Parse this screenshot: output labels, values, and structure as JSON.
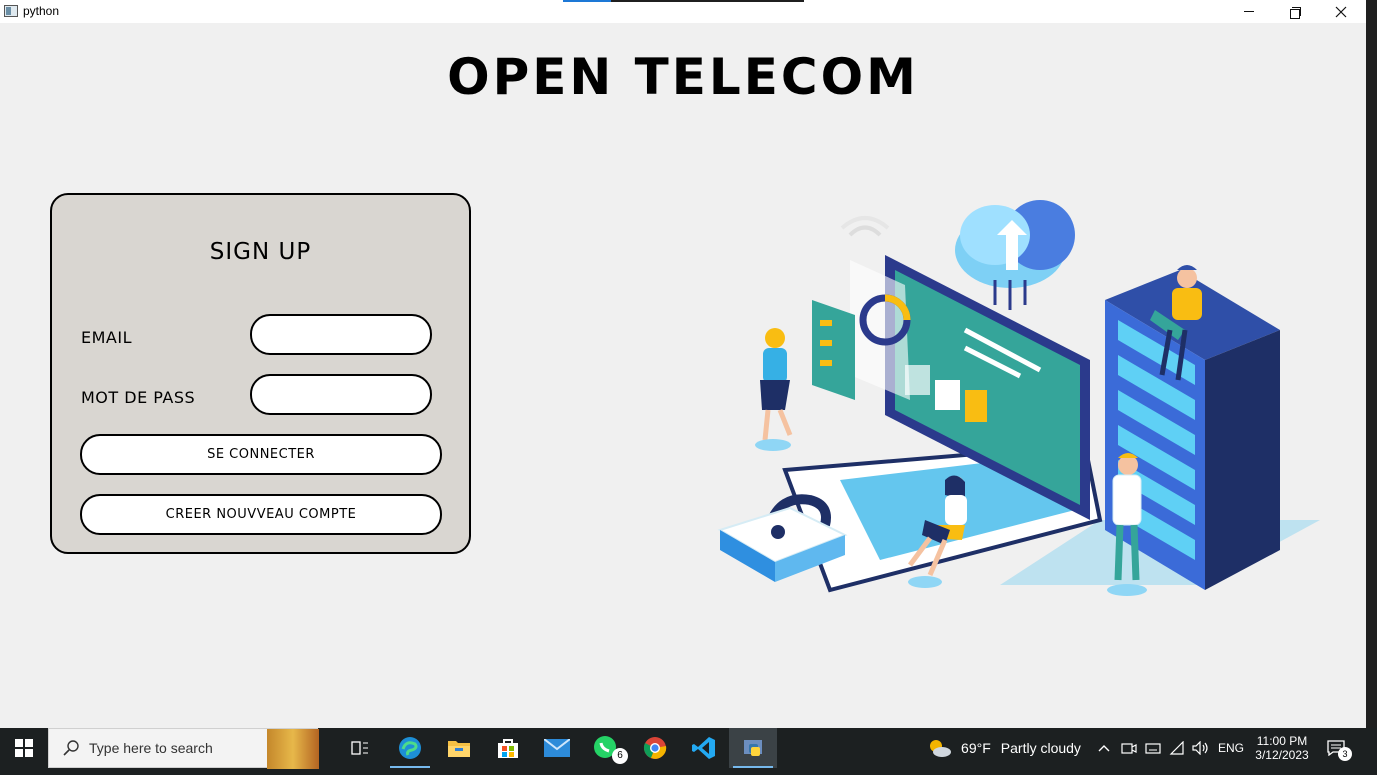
{
  "window": {
    "title": "python"
  },
  "header": {
    "title": "OPEN TELECOM"
  },
  "form": {
    "title": "SIGN UP",
    "email_label": "EMAIL",
    "email_value": "",
    "password_label": "MOT DE PASS",
    "password_value": "",
    "login_button": "SE CONNECTER",
    "create_button": "CREER NOUVVEAU COMPTE"
  },
  "taskbar": {
    "search_placeholder": "Type here to search",
    "apps": [
      "task-view",
      "edge",
      "file-explorer",
      "microsoft-store",
      "mail",
      "whatsapp",
      "chrome",
      "vscode",
      "python"
    ],
    "whatsapp_badge": "6",
    "weather_temp": "69°F",
    "weather_desc": "Partly cloudy",
    "language": "ENG",
    "time": "11:00 PM",
    "date": "3/12/2023",
    "notification_count": "3"
  },
  "colors": {
    "card_bg": "#d9d6d1",
    "window_bg": "#f0f0f0",
    "taskbar_bg": "#1c2021",
    "accent_teal": "#35a59a",
    "accent_blue": "#2f5fd7",
    "accent_yellow": "#f9bd12"
  }
}
